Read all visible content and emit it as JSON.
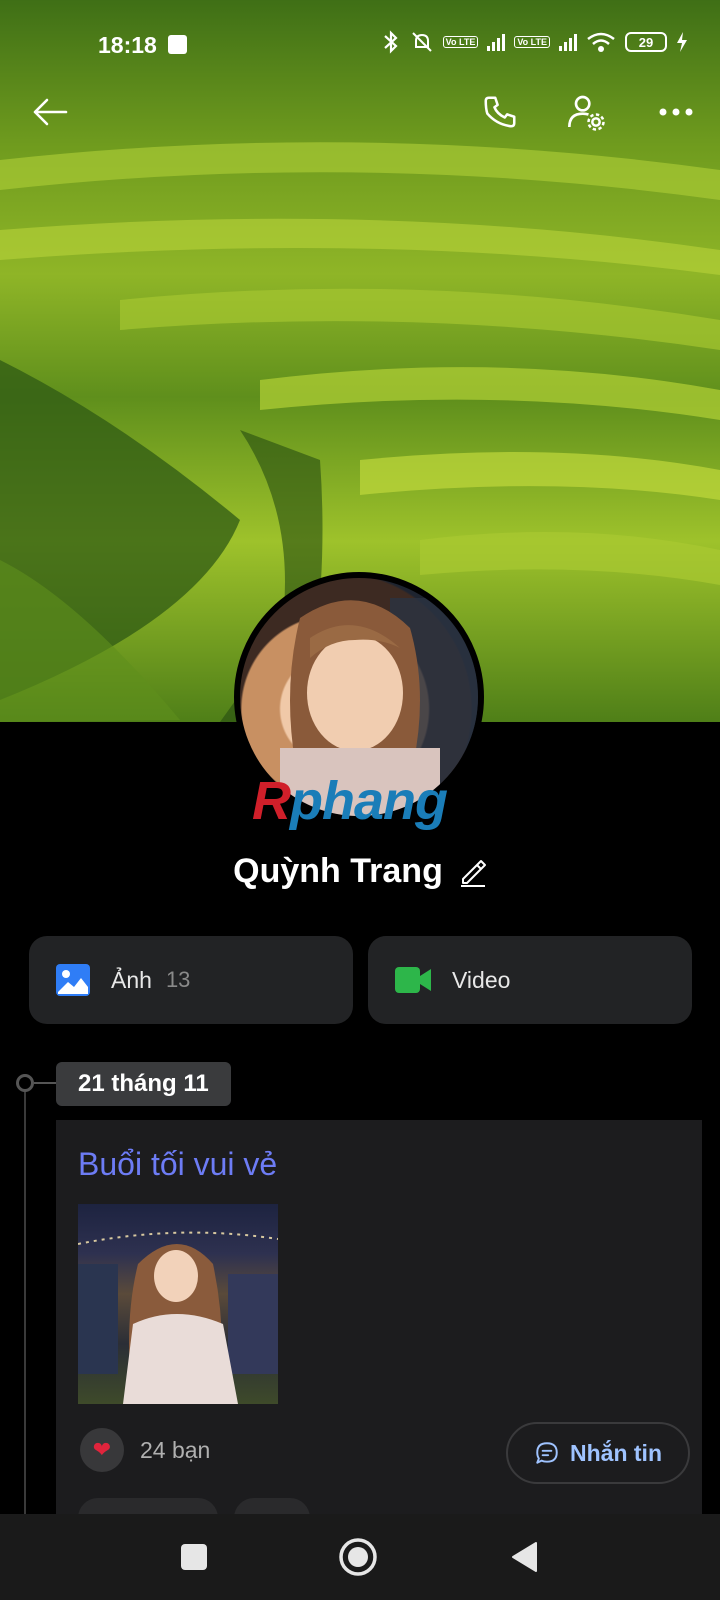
{
  "status_bar": {
    "time": "18:18",
    "battery": "29",
    "lte_label_1": "Vo LTE",
    "lte_label_2": "Vo LTE"
  },
  "header": {
    "back_icon": "back-arrow-icon",
    "call_icon": "phone-icon",
    "settings_icon": "user-settings-icon",
    "more_icon": "more-icon"
  },
  "watermark": {
    "part1": "R",
    "part2": "phang"
  },
  "profile": {
    "name": "Quỳnh Trang"
  },
  "media": {
    "photos_label": "Ảnh",
    "photos_count": "13",
    "video_label": "Video"
  },
  "timeline": {
    "date": "21 tháng 11",
    "post": {
      "title": "Buổi tối vui vẻ",
      "likes": "24 bạn",
      "message_label": "Nhắn tin"
    }
  },
  "colors": {
    "accent_title": "#6d7cf5",
    "message_text": "#9fc3ff",
    "photo_icon": "#2f7df6",
    "video_icon": "#2db64a",
    "heart": "#e0243c"
  }
}
